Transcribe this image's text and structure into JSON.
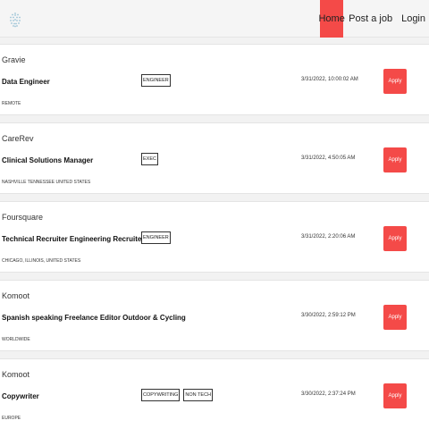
{
  "nav": {
    "logo_icon": "globe-icon",
    "links": [
      {
        "label": "Home",
        "active": true
      },
      {
        "label": "Post a job",
        "active": false
      },
      {
        "label": "Login",
        "active": false
      }
    ]
  },
  "accent_color": "#f44a48",
  "jobs": [
    {
      "company": "Gravie",
      "title": "Data Engineer",
      "location": "REMOTE",
      "tags": [
        "ENGINEER"
      ],
      "date": "3/31/2022, 10:00:02 AM",
      "apply_label": "Apply"
    },
    {
      "company": "CareRev",
      "title": "Clinical Solutions Manager",
      "location": "NASHVILLE TENNESSEE UNITED STATES",
      "tags": [
        "EXEC"
      ],
      "date": "3/31/2022, 4:50:05 AM",
      "apply_label": "Apply"
    },
    {
      "company": "Foursquare",
      "title": "Technical Recruiter Engineering Recruiter",
      "location": "CHICAGO, ILLINOIS, UNITED STATES",
      "tags": [
        "ENGINEER"
      ],
      "date": "3/31/2022, 2:20:06 AM",
      "apply_label": "Apply"
    },
    {
      "company": "Komoot",
      "title": "Spanish speaking Freelance Editor Outdoor & Cycling",
      "location": "WORLDWIDE",
      "tags": [],
      "date": "3/30/2022, 2:59:12 PM",
      "apply_label": "Apply"
    },
    {
      "company": "Komoot",
      "title": "Copywriter",
      "location": "EUROPE",
      "tags": [
        "COPYWRITING",
        "NON TECH"
      ],
      "date": "3/30/2022, 2:37:24 PM",
      "apply_label": "Apply"
    }
  ]
}
